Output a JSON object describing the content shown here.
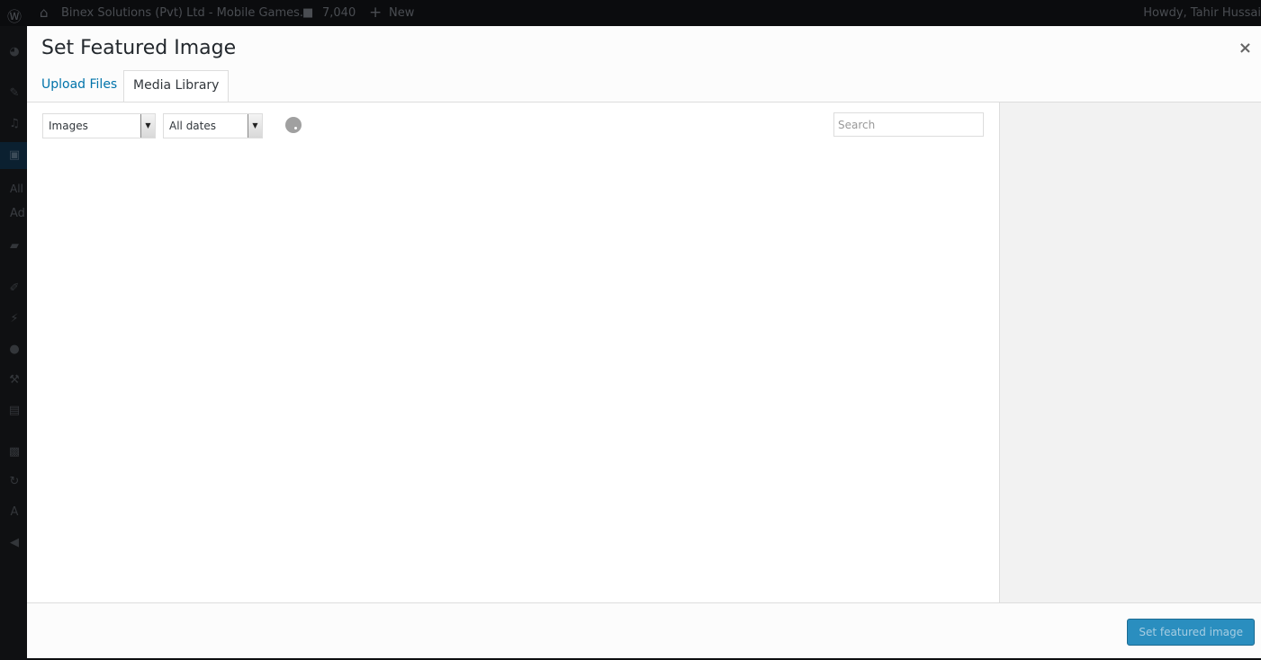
{
  "admin_bar": {
    "site_name": "Binex Solutions (Pvt) Ltd - Mobile Games...",
    "comments_count": "7,040",
    "new_label": "New",
    "greeting": "Howdy, Tahir Hussai"
  },
  "sidebar": {
    "submenu": [
      "All",
      "Ad"
    ],
    "icons": [
      "dashboard-icon",
      "pin-icon",
      "media-icon",
      "pages-icon",
      "comments-icon",
      "appearance-icon",
      "plugins-icon",
      "users-icon",
      "tools-icon",
      "settings-icon",
      "thumbs-up-icon",
      "refresh-icon",
      "font-icon",
      "collapse-icon"
    ]
  },
  "modal": {
    "title": "Set Featured Image",
    "close": "×",
    "tabs": [
      {
        "label": "Upload Files",
        "active": false
      },
      {
        "label": "Media Library",
        "active": true
      }
    ],
    "filters": {
      "type_selected": "Images",
      "date_selected": "All dates"
    },
    "search": {
      "placeholder": "Search",
      "value": ""
    },
    "primary_button": "Set featured image"
  },
  "colors": {
    "accent": "#0073aa",
    "button": "#2a8ebf"
  }
}
